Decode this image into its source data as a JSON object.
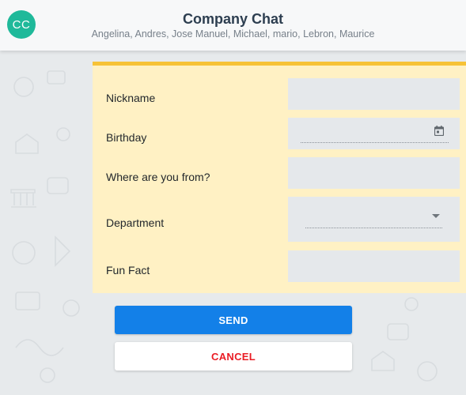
{
  "header": {
    "avatar_initials": "CC",
    "title": "Company Chat",
    "members": "Angelina, Andres, Jose Manuel, Michael, mario, Lebron, Maurice"
  },
  "form": {
    "fields": [
      {
        "label": "Nickname",
        "type": "text",
        "value": ""
      },
      {
        "label": "Birthday",
        "type": "date",
        "value": ""
      },
      {
        "label": "Where are you from?",
        "type": "text",
        "value": ""
      },
      {
        "label": "Department",
        "type": "select",
        "value": ""
      },
      {
        "label": "Fun Fact",
        "type": "text",
        "value": ""
      }
    ]
  },
  "actions": {
    "send_label": "SEND",
    "cancel_label": "CANCEL"
  },
  "colors": {
    "avatar": "#1fb99a",
    "form_background": "#fff1c4",
    "form_accent": "#f6c237",
    "send_button": "#1380e8",
    "cancel_text": "#ea1c24"
  }
}
